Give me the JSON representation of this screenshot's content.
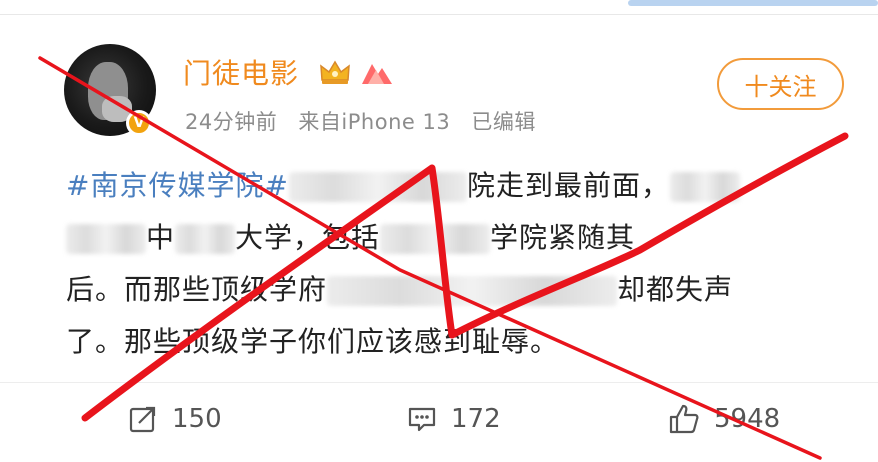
{
  "post": {
    "username": "门徒电影",
    "time": "24分钟前",
    "source": "来自iPhone 13",
    "edited": "已编辑",
    "follow_label": "十关注",
    "verified_badge": "V",
    "body": {
      "topic": "#南京传媒学院#",
      "line1_tail": "院走到最前面，",
      "line2_a": "中",
      "line2_b": "大学，包括",
      "line2_c": "学院紧随其",
      "line3_a": "后。而那些顶级学府",
      "line3_b": "却都失声",
      "line4": "了。那些顶级学子你们应该感到耻辱。"
    }
  },
  "actions": {
    "repost_count": "150",
    "comment_count": "172",
    "like_count": "5948"
  },
  "colors": {
    "brand_orange": "#f08a1e",
    "topic_blue": "#4a7fbf",
    "annotation_red": "#e8141c"
  },
  "icons": [
    "crown-icon",
    "mountain-icon",
    "repost-icon",
    "comment-icon",
    "like-icon"
  ]
}
